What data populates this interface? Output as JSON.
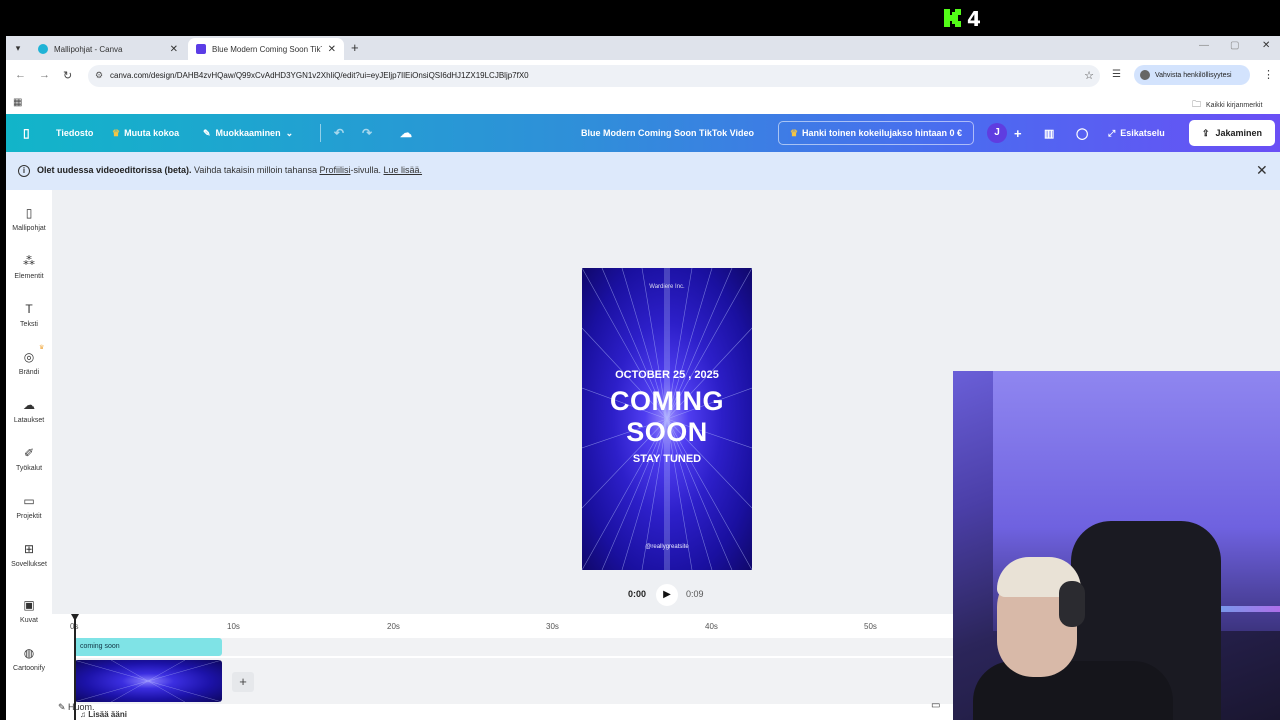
{
  "stream": {
    "k_number": "4"
  },
  "browser": {
    "tabs": [
      {
        "title": "Mallipohjat - Canva"
      },
      {
        "title": "Blue Modern Coming Soon TikTok"
      }
    ],
    "url": "canva.com/design/DAHB4zvHQaw/Q99xCvAdHD3YGN1v2XhliQ/edit?ui=eyJEljp7IlEiOnsiQSI6dHJ1ZX19LCJBljp7fX0",
    "profile_chip": "Vahvista henkilöllisyytesi",
    "bookmarks_all": "Kaikki kirjanmerkit"
  },
  "toolbar": {
    "file": "Tiedosto",
    "resize": "Muuta kokoa",
    "editing": "Muokkaaminen",
    "design_title": "Blue Modern Coming Soon TikTok Video",
    "trial": "Hanki toinen kokeilujakso hintaan 0 €",
    "avatar_letter": "J",
    "preview": "Esikatselu",
    "share": "Jakaminen"
  },
  "banner": {
    "bold": "Olet uudessa videoeditorissa (beta).",
    "text1": " Vaihda takaisin milloin tahansa ",
    "link1": "Profiilisi",
    "text2": "-sivulla. ",
    "link2": "Lue lisää."
  },
  "sidebar": {
    "items": [
      {
        "label": "Mallipohjat",
        "icon": "template-icon"
      },
      {
        "label": "Elementit",
        "icon": "elements-icon"
      },
      {
        "label": "Teksti",
        "icon": "text-icon"
      },
      {
        "label": "Brändi",
        "icon": "brand-icon"
      },
      {
        "label": "Lataukset",
        "icon": "upload-icon"
      },
      {
        "label": "Työkalut",
        "icon": "tools-icon"
      },
      {
        "label": "Projektit",
        "icon": "folder-icon"
      },
      {
        "label": "Sovellukset",
        "icon": "apps-icon"
      },
      {
        "label": "Kuvat",
        "icon": "image-icon"
      },
      {
        "label": "Cartoonify",
        "icon": "cartoonify-icon"
      }
    ]
  },
  "poster": {
    "brand": "Wardiere Inc.",
    "date": "OCTOBER 25 , 2025",
    "line1": "COMING",
    "line2": "SOON",
    "tagline": "STAY TUNED",
    "site": "@reallygreatsite"
  },
  "player": {
    "current": "0:00",
    "total": "0:09"
  },
  "timeline": {
    "ticks": [
      "0s",
      "10s",
      "20s",
      "30s",
      "40s",
      "50s"
    ],
    "text_clip": "coming soon",
    "add_audio": "Lisää ääni",
    "notes": "Huom."
  }
}
